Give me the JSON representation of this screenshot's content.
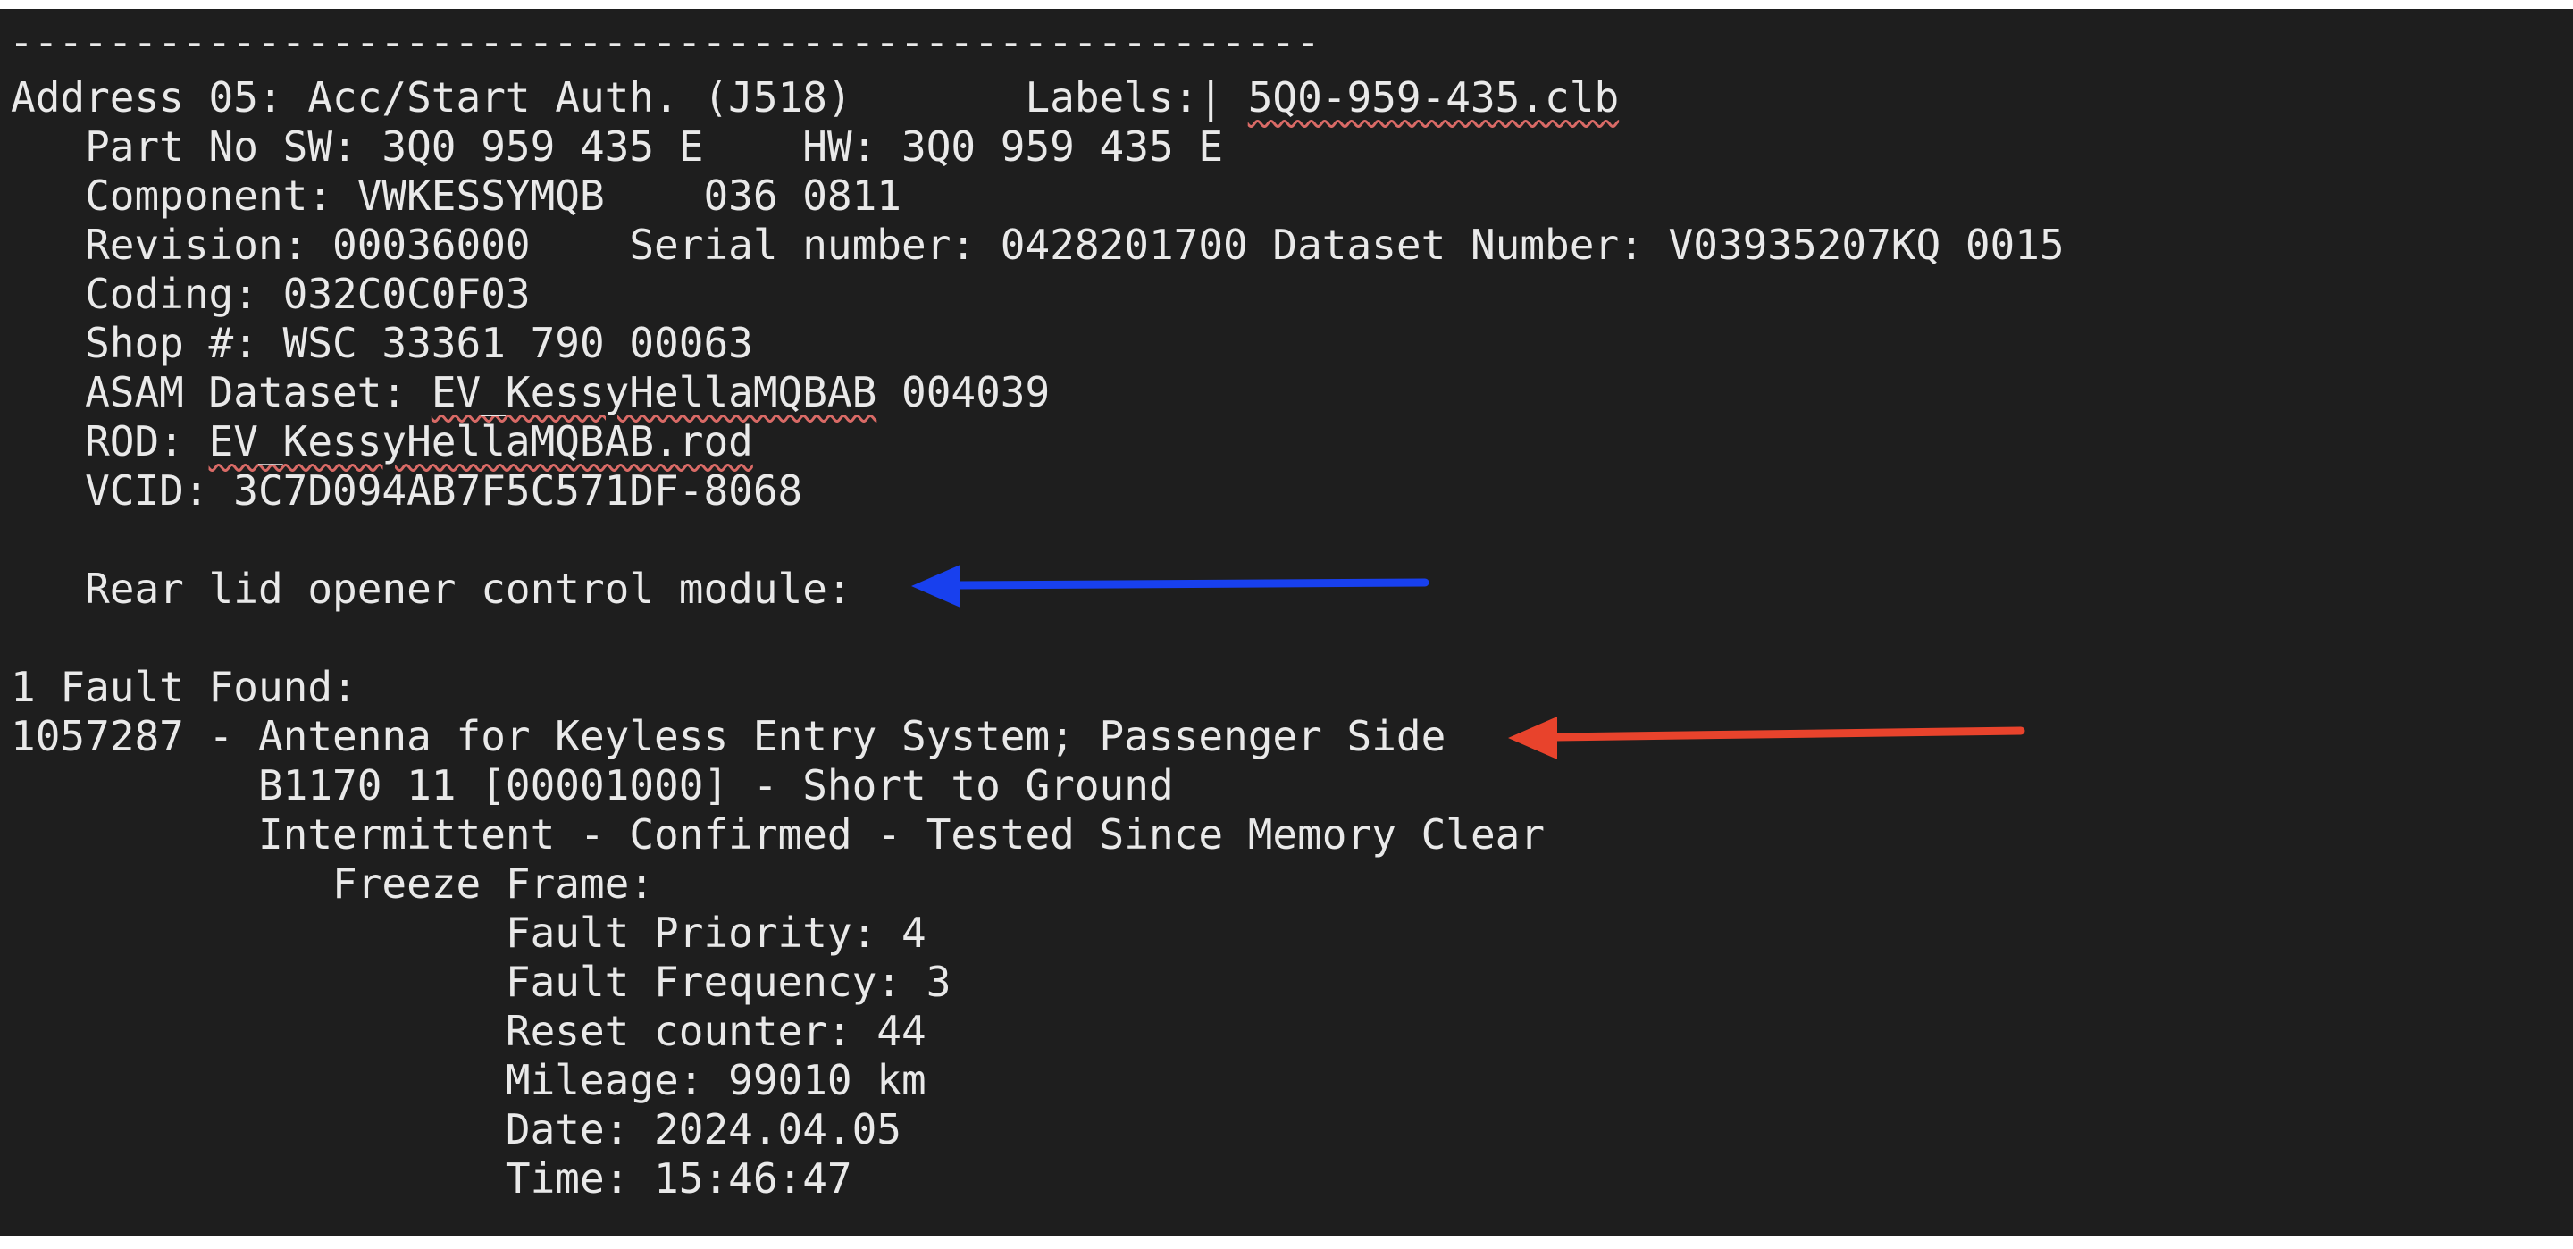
{
  "terminal": {
    "separator": "-----------------------------------------------------",
    "address_line": {
      "prefix": "Address 05: Acc/Start Auth. (J518)       Labels:| ",
      "label_file": "5Q0-959-435.clb"
    },
    "part_no": "   Part No SW: 3Q0 959 435 E    HW: 3Q0 959 435 E",
    "component": "   Component: VWKESSYMQB    036 0811",
    "revision": "   Revision: 00036000    Serial number: 0428201700 Dataset Number: V03935207KQ 0015",
    "coding": "   Coding: 032C0C0F03",
    "shop": "   Shop #: WSC 33361 790 00063",
    "asam_line": {
      "prefix": "   ASAM Dataset: ",
      "dataset": "EV_KessyHellaMQBAB",
      "suffix": " 004039"
    },
    "rod_line": {
      "prefix": "   ROD: ",
      "file": "EV_KessyHellaMQBAB.rod"
    },
    "vcid": "   VCID: 3C7D094AB7F5C571DF-8068",
    "subsystem": "   Rear lid opener control module:",
    "fault_count": "1 Fault Found:",
    "fault_title": "1057287 - Antenna for Keyless Entry System; Passenger Side",
    "fault_code": "          B1170 11 [00001000] - Short to Ground",
    "fault_status": "          Intermittent - Confirmed - Tested Since Memory Clear",
    "freeze_frame": "             Freeze Frame:",
    "fault_priority": "                    Fault Priority: 4",
    "fault_frequency": "                    Fault Frequency: 3",
    "reset_counter": "                    Reset counter: 44",
    "mileage": "                    Mileage: 99010 km",
    "date": "                    Date: 2024.04.05",
    "time": "                    Time: 15:46:47"
  },
  "colors": {
    "background": "#1e1e1e",
    "text": "#e9e9e9",
    "blue_arrow": "#1840ee",
    "red_arrow": "#e8432c",
    "spell_underline": "#d96a66"
  }
}
